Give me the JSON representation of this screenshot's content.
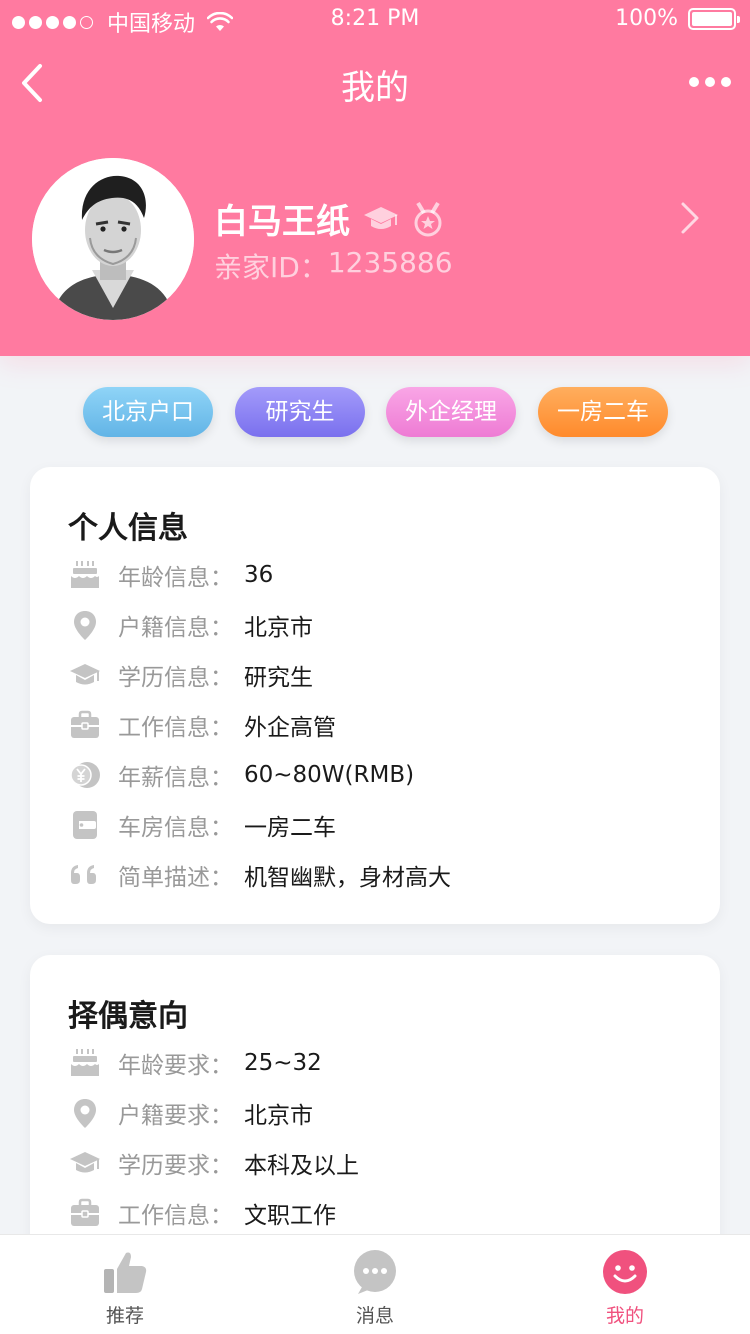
{
  "status_bar": {
    "carrier": "中国移动",
    "time": "8:21 PM",
    "battery": "100%",
    "signal_bars_filled": 4,
    "signal_bars_total": 5,
    "battery_level": 1.0
  },
  "navbar": {
    "title": "我的",
    "back_icon": "chevron-left-icon",
    "more_icon": "more-dots-icon"
  },
  "profile": {
    "name": "白马王纸",
    "id_label": "亲家ID：",
    "id_value": "1235886",
    "badges": [
      "graduation-cap-icon",
      "medal-icon"
    ]
  },
  "tags": [
    {
      "label": "北京户口",
      "color": "#7ec8f0"
    },
    {
      "label": "研究生",
      "color": "#8f86f5"
    },
    {
      "label": "外企经理",
      "color": "#f58fdc"
    },
    {
      "label": "一房二车",
      "color": "#ff9a3d"
    }
  ],
  "personal_info": {
    "title": "个人信息",
    "rows": [
      {
        "icon": "birthday-cake-icon",
        "label": "年龄信息：",
        "value": "36"
      },
      {
        "icon": "location-pin-icon",
        "label": "户籍信息：",
        "value": "北京市"
      },
      {
        "icon": "graduation-cap-icon",
        "label": "学历信息：",
        "value": "研究生"
      },
      {
        "icon": "briefcase-icon",
        "label": "工作信息：",
        "value": "外企高管"
      },
      {
        "icon": "yuan-coin-icon",
        "label": "年薪信息：",
        "value": "60~80W(RMB)"
      },
      {
        "icon": "wallet-icon",
        "label": "车房信息：",
        "value": "一房二车"
      },
      {
        "icon": "quote-icon",
        "label": "简单描述：",
        "value": "机智幽默，身材高大"
      }
    ]
  },
  "partner_preference": {
    "title": "择偶意向",
    "rows": [
      {
        "icon": "birthday-cake-icon",
        "label": "年龄要求：",
        "value": "25~32"
      },
      {
        "icon": "location-pin-icon",
        "label": "户籍要求：",
        "value": "北京市"
      },
      {
        "icon": "graduation-cap-icon",
        "label": "学历要求：",
        "value": "本科及以上"
      },
      {
        "icon": "briefcase-icon",
        "label": "工作信息：",
        "value": "文职工作"
      }
    ]
  },
  "tabbar": {
    "tabs": [
      {
        "label": "推荐",
        "icon": "thumbs-up-icon",
        "active": false
      },
      {
        "label": "消息",
        "icon": "chat-bubble-icon",
        "active": false
      },
      {
        "label": "我的",
        "icon": "smiley-icon",
        "active": true
      }
    ]
  },
  "colors": {
    "header": "#ff7aa0",
    "accent": "#f0517e",
    "icon_gray": "#c4c4c4"
  }
}
